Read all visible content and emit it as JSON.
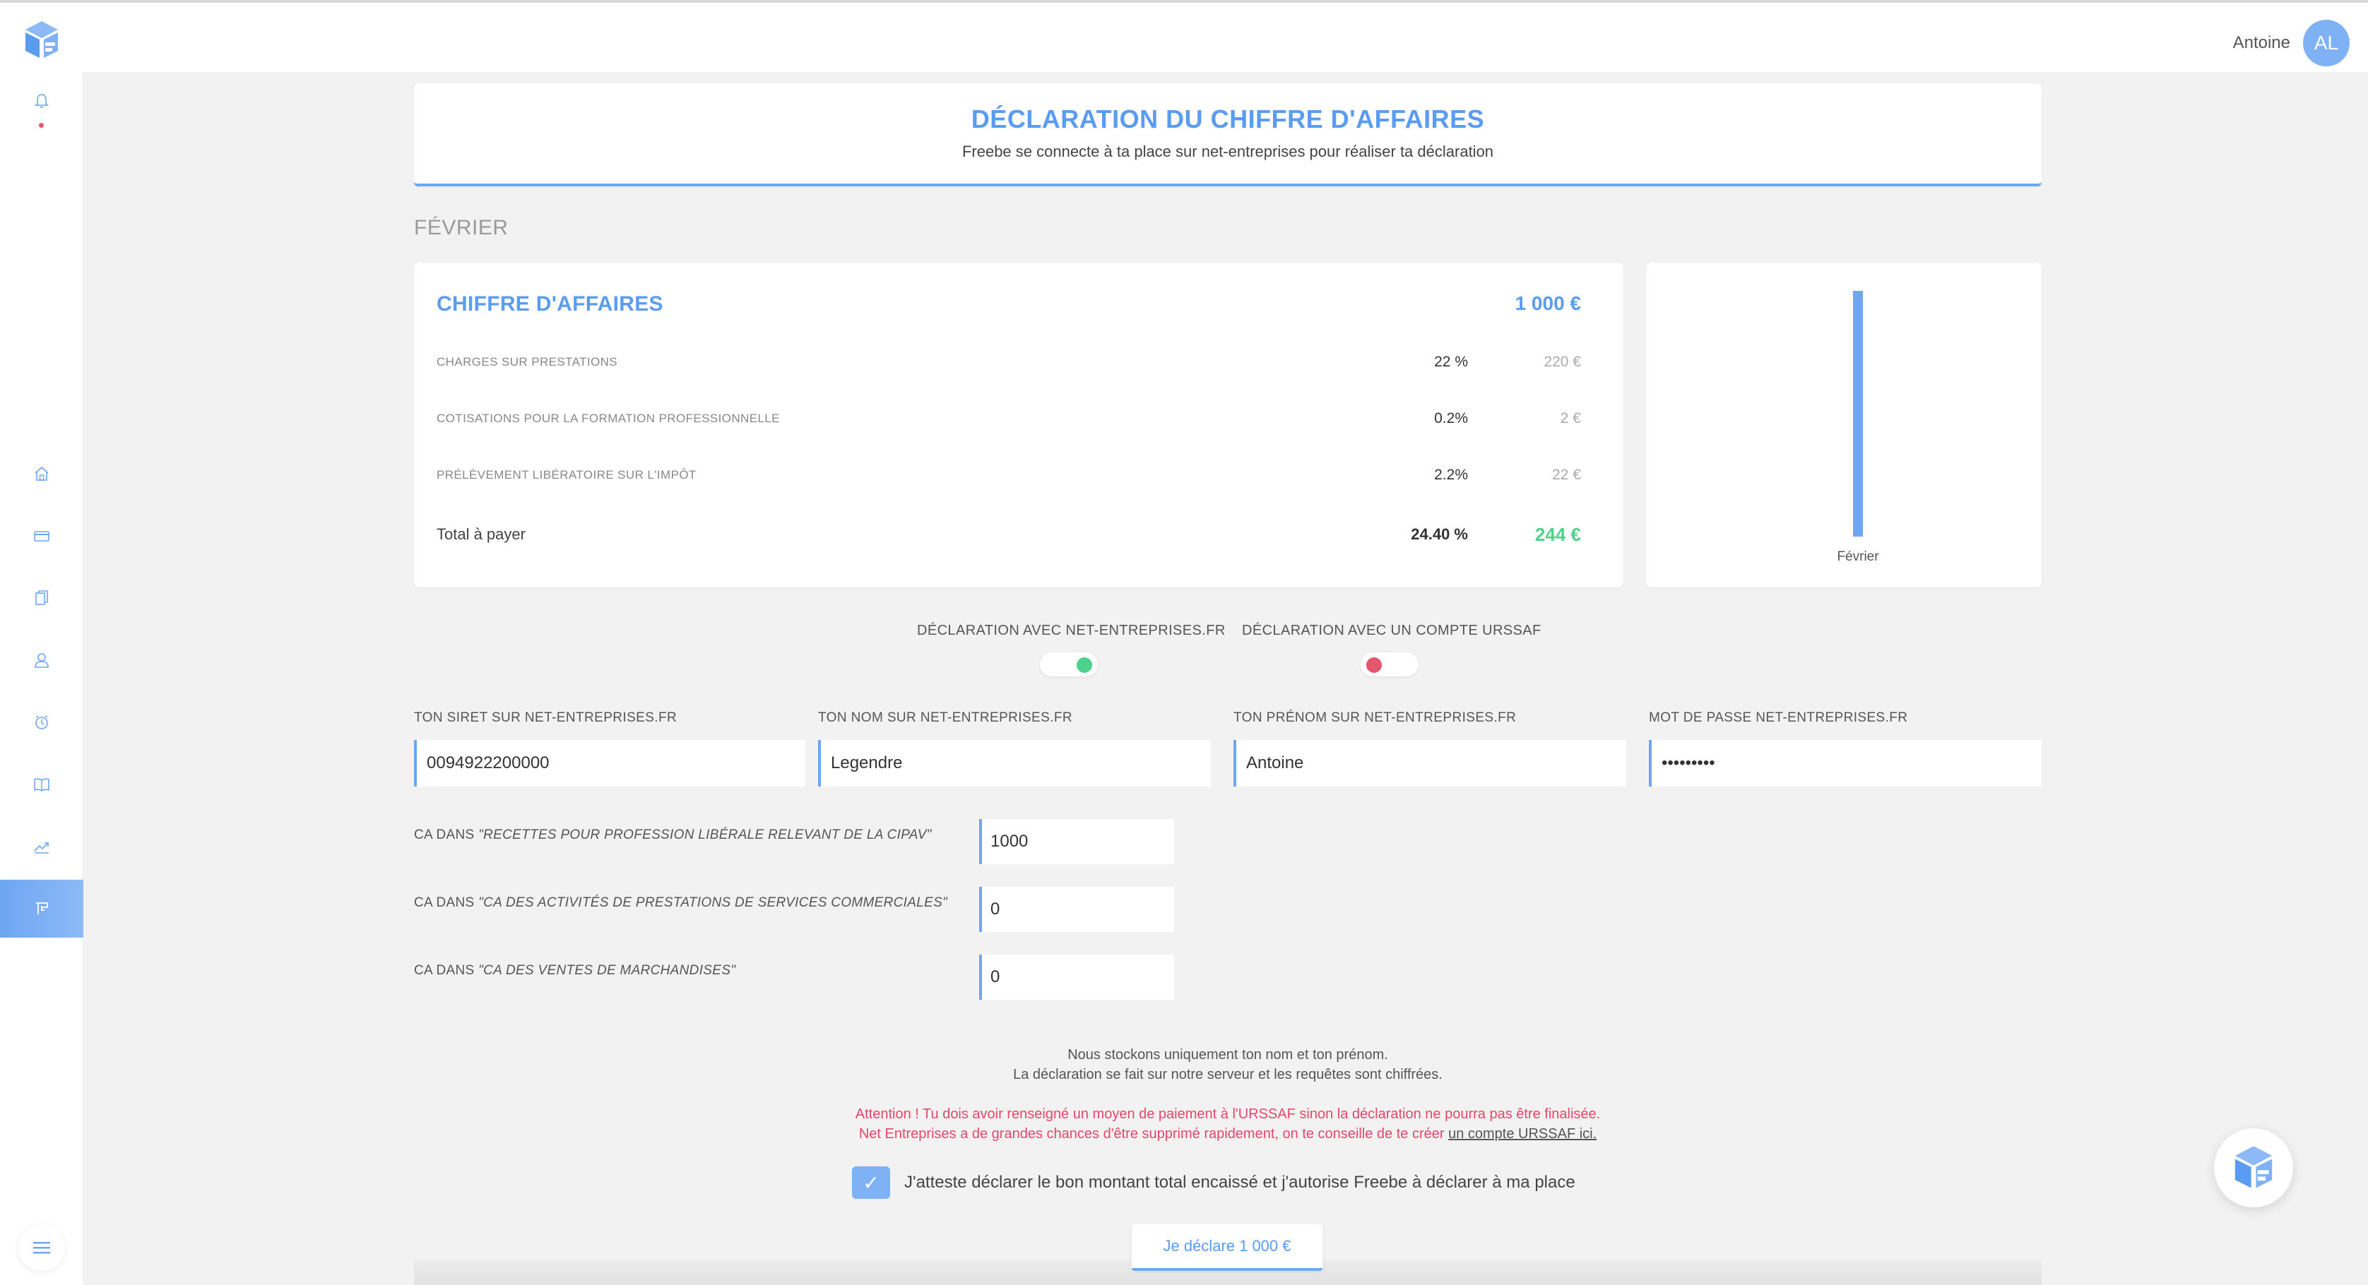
{
  "user": {
    "name": "Antoine",
    "initials": "AL"
  },
  "sidebar": {
    "items": [
      {
        "icon": "home-icon"
      },
      {
        "icon": "credit-card-icon"
      },
      {
        "icon": "documents-icon"
      },
      {
        "icon": "user-icon"
      },
      {
        "icon": "clock-icon"
      },
      {
        "icon": "book-icon"
      },
      {
        "icon": "trending-icon"
      },
      {
        "icon": "declaration-icon",
        "active": true
      }
    ]
  },
  "header": {
    "title": "DÉCLARATION DU CHIFFRE D'AFFAIRES",
    "subtitle": "Freebe se connecte à ta place sur net-entreprises pour réaliser ta déclaration"
  },
  "period": {
    "month": "FÉVRIER"
  },
  "summary": {
    "title": "CHIFFRE D'AFFAIRES",
    "amount": "1 000  €",
    "rows": [
      {
        "label": "CHARGES SUR PRESTATIONS",
        "rate": "22 %",
        "amount": "220 €"
      },
      {
        "label": "COTISATIONS POUR LA FORMATION PROFESSIONNELLE",
        "rate": "0.2%",
        "amount": "2 €"
      },
      {
        "label": "PRÉLÈVEMENT LIBÉRATOIRE SUR L'IMPÔT",
        "rate": "2.2%",
        "amount": "22 €"
      }
    ],
    "total": {
      "label": "Total à payer",
      "rate": "24.40 %",
      "amount": "244  €"
    }
  },
  "chart_data": {
    "type": "bar",
    "categories": [
      "Février"
    ],
    "values": [
      1000
    ],
    "color": "#6ea6f3"
  },
  "toggles": {
    "net_entreprises": {
      "label": "DÉCLARATION AVEC NET-ENTREPRISES.FR",
      "state": "on",
      "color": "#4cd28a"
    },
    "urssaf": {
      "label": "DÉCLARATION AVEC UN COMPTE URSSAF",
      "state": "off",
      "color": "#e5566f"
    }
  },
  "credentials": {
    "siret": {
      "label": "TON SIRET SUR NET-ENTREPRISES.FR",
      "value": "0094922200000"
    },
    "nom": {
      "label": "TON NOM SUR NET-ENTREPRISES.FR",
      "value": "Legendre"
    },
    "prenom": {
      "label": "TON PRÉNOM SUR NET-ENTREPRISES.FR",
      "value": "Antoine"
    },
    "password": {
      "label": "MOT DE PASSE NET-ENTREPRISES.FR",
      "value": "•••••••••"
    }
  },
  "ca_lines": [
    {
      "prefix": "CA DANS ",
      "category": "\"RECETTES POUR PROFESSION LIBÉRALE RELEVANT DE LA CIPAV\"",
      "value": "1000"
    },
    {
      "prefix": "CA DANS ",
      "category": "\"CA DES ACTIVITÉS DE PRESTATIONS DE SERVICES COMMERCIALES\"",
      "value": "0"
    },
    {
      "prefix": "CA DANS ",
      "category": "\"CA DES VENTES DE MARCHANDISES\"",
      "value": "0"
    }
  ],
  "info": {
    "line1": "Nous stockons uniquement ton nom et ton prénom.",
    "line2": "La déclaration se fait sur notre serveur et les requêtes sont chiffrées."
  },
  "warning": {
    "line1": "Attention ! Tu dois avoir renseigné un moyen de paiement à l'URSSAF sinon la déclaration ne pourra pas être finalisée.",
    "line2": "Net Entreprises a de grandes chances d'être supprimé rapidement, on te conseille de te créer ",
    "link": "un compte URSSAF ici."
  },
  "attest": {
    "checked": true,
    "text": "J'atteste déclarer le bon montant total encaissé et j'autorise Freebe à déclarer à ma place"
  },
  "submit": {
    "label": "Je déclare 1 000 €"
  },
  "colors": {
    "accent": "#6ea6f3",
    "accent_text": "#5a9cf0",
    "success": "#4cd28a",
    "danger": "#e5466a"
  }
}
